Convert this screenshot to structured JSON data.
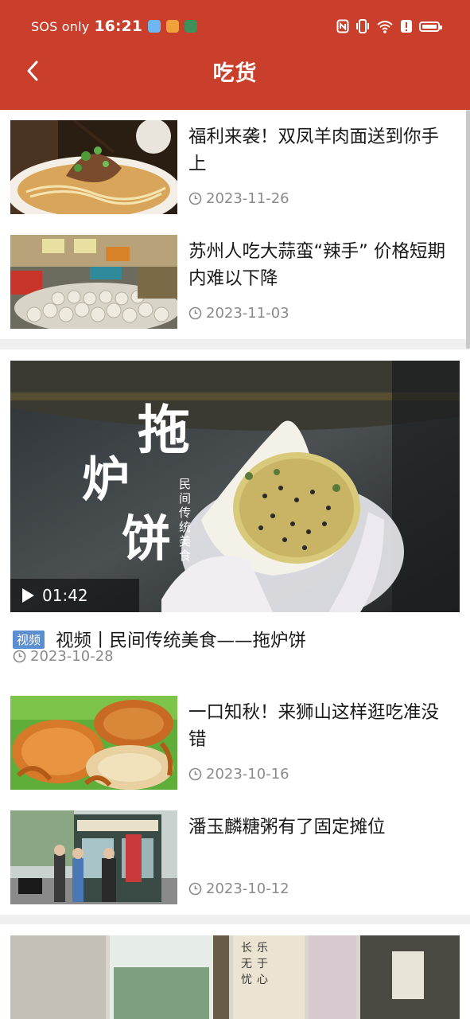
{
  "status_bar": {
    "carrier": "SOS only",
    "time": "16:21",
    "battery_level": 0.8
  },
  "header": {
    "title": "吃货",
    "back_icon": "chevron-left-icon"
  },
  "articles_top": [
    {
      "title": "福利来袭！双凤羊肉面送到你手上",
      "date": "2023-11-26",
      "image": "noodle-bowl"
    },
    {
      "title": "苏州人吃大蒜蛮“辣手” 价格短期内难以下降",
      "date": "2023-11-03",
      "image": "garlic-market"
    }
  ],
  "video": {
    "overlay_main": "拖炉饼",
    "overlay_sub": "民间传统美食",
    "duration": "01:42",
    "badge": "视频",
    "title": "视频丨民间传统美食——拖炉饼",
    "date": "2023-10-28"
  },
  "articles_bottom": [
    {
      "title": "一口知秋！来狮山这样逛吃准没错",
      "date": "2023-10-16",
      "image": "crabs"
    },
    {
      "title": "潘玉麟糖粥有了固定摊位",
      "date": "2023-10-12",
      "image": "street-stall"
    }
  ],
  "colors": {
    "header": "#c93f2c",
    "badge": "#5c8fd0",
    "date_text": "#8a8a8a"
  }
}
